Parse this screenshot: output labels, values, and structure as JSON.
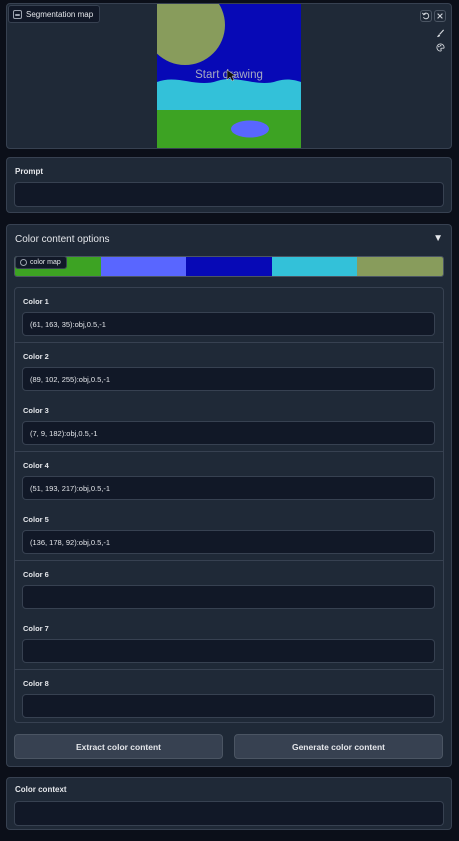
{
  "canvas": {
    "tag_label": "Segmentation map",
    "overlay_text": "Start drawing",
    "undo_icon": "undo-icon",
    "clear_icon": "close-icon",
    "brush_icon": "brush-icon",
    "palette_icon": "palette-icon",
    "colors": {
      "sky": "#0709b6",
      "sun": "#889c5c",
      "water": "#33c1d9",
      "grass": "#3da323",
      "pond": "#5966ff"
    }
  },
  "prompt": {
    "label": "Prompt",
    "value": ""
  },
  "accordion": {
    "title": "Color content options",
    "caret": "▼",
    "color_map_tag": "color map",
    "color_map": [
      "#3da323",
      "#5966ff",
      "#0709b6",
      "#33c1d9",
      "#889c5c"
    ],
    "colors": [
      {
        "label": "Color 1",
        "value": "(61, 163, 35):obj,0.5,-1"
      },
      {
        "label": "Color 2",
        "value": "(89, 102, 255):obj,0.5,-1"
      },
      {
        "label": "Color 3",
        "value": "(7, 9, 182):obj,0.5,-1"
      },
      {
        "label": "Color 4",
        "value": "(51, 193, 217):obj,0.5,-1"
      },
      {
        "label": "Color 5",
        "value": "(136, 178, 92):obj,0.5,-1"
      },
      {
        "label": "Color 6",
        "value": ""
      },
      {
        "label": "Color 7",
        "value": ""
      },
      {
        "label": "Color 8",
        "value": ""
      }
    ],
    "extract_button": "Extract color content",
    "generate_button": "Generate color content"
  },
  "context": {
    "label": "Color context",
    "value": ""
  }
}
